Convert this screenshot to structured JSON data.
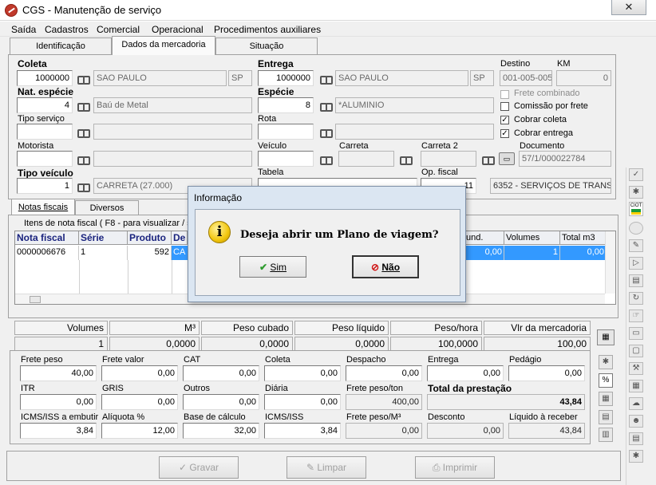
{
  "window": {
    "title": "CGS - Manutenção de serviço",
    "close": "✕"
  },
  "menu": [
    "Saída",
    "Cadastros",
    "Comercial",
    "Operacional",
    "Procedimentos auxiliares"
  ],
  "tabs": [
    "Identificação",
    "Dados da mercadoria",
    "Situação"
  ],
  "form": {
    "coleta": {
      "label": "Coleta",
      "code": "1000000",
      "city": "SAO PAULO",
      "uf": "SP"
    },
    "entrega": {
      "label": "Entrega",
      "code": "1000000",
      "city": "SAO PAULO",
      "uf": "SP"
    },
    "destino": {
      "label": "Destino",
      "value": "001-005-005"
    },
    "km": {
      "label": "KM",
      "value": "0"
    },
    "nat_especie": {
      "label": "Nat. espécie",
      "code": "4",
      "desc": "Baú de Metal"
    },
    "especie": {
      "label": "Espécie",
      "code": "8",
      "desc": "*ALUMINIO"
    },
    "frete_combinado": "Frete combinado",
    "comissao_frete": "Comissão por frete",
    "cobrar_coleta": "Cobrar coleta",
    "cobrar_entrega": "Cobrar entrega",
    "check_mark": "✓",
    "tipo_servico": {
      "label": "Tipo serviço",
      "code": "",
      "desc": ""
    },
    "rota": {
      "label": "Rota",
      "code": "",
      "desc": ""
    },
    "motorista": {
      "label": "Motorista",
      "value": ""
    },
    "veiculo": {
      "label": "Veículo",
      "value": ""
    },
    "carreta": {
      "label": "Carreta",
      "value": ""
    },
    "carreta2": {
      "label": "Carreta 2",
      "value": ""
    },
    "documento": {
      "label": "Documento",
      "value": "57/1/000022784"
    },
    "tipo_veiculo": {
      "label": "Tipo veículo",
      "code": "1",
      "desc": "CARRETA (27.000)"
    },
    "tabela": {
      "label": "Tabela"
    },
    "op_fiscal": {
      "label": "Op. fiscal",
      "code": "11",
      "desc": "6352 - SERVIÇOS DE TRANSPOI"
    }
  },
  "lower_tabs": [
    "Notas fiscais",
    "Diversos"
  ],
  "items_caption": "Itens de nota fiscal ( F8 - para visualizar / s",
  "grid": {
    "headers": [
      "Nota fiscal",
      "Série",
      "Produto",
      "De",
      "und.",
      "Volumes",
      "Total m3"
    ],
    "row": [
      "0000006676",
      "1",
      "592",
      "CA",
      "0,00",
      "1",
      "0,00"
    ]
  },
  "summary": {
    "headers": [
      "Volumes",
      "M³",
      "Peso cubado",
      "Peso líquido",
      "Peso/hora",
      "Vlr da mercadoria"
    ],
    "values": [
      "1",
      "0,0000",
      "0,0000",
      "0,0000",
      "100,0000",
      "100,00"
    ]
  },
  "financial": {
    "frete_peso": {
      "label": "Frete peso",
      "value": "40,00"
    },
    "frete_valor": {
      "label": "Frete valor",
      "value": "0,00"
    },
    "cat": {
      "label": "CAT",
      "value": "0,00"
    },
    "coleta": {
      "label": "Coleta",
      "value": "0,00"
    },
    "despacho": {
      "label": "Despacho",
      "value": "0,00"
    },
    "entrega": {
      "label": "Entrega",
      "value": "0,00"
    },
    "pedagio": {
      "label": "Pedágio",
      "value": "0,00"
    },
    "itr": {
      "label": "ITR",
      "value": "0,00"
    },
    "gris": {
      "label": "GRIS",
      "value": "0,00"
    },
    "outros": {
      "label": "Outros",
      "value": "0,00"
    },
    "diaria": {
      "label": "Diária",
      "value": "0,00"
    },
    "frete_peso_ton": {
      "label": "Frete peso/ton",
      "value": "400,00"
    },
    "total_prestacao": {
      "label": "Total da prestação",
      "value": "43,84"
    },
    "icms_embutir": {
      "label": "ICMS/ISS a embutir",
      "value": "3,84"
    },
    "aliquota": {
      "label": "Alíquota %",
      "value": "12,00"
    },
    "base_calculo": {
      "label": "Base de cálculo",
      "value": "32,00"
    },
    "icms_iss": {
      "label": "ICMS/ISS",
      "value": "3,84"
    },
    "frete_peso_m3": {
      "label": "Frete peso/M³",
      "value": "0,00"
    },
    "desconto": {
      "label": "Desconto",
      "value": "0,00"
    },
    "liquido": {
      "label": "Líquido à receber",
      "value": "43,84"
    }
  },
  "buttons": {
    "gravar": "Gravar",
    "limpar": "Limpar",
    "imprimir": "Imprimir"
  },
  "side_ciot": "CIOT",
  "dialog": {
    "title": "Informação",
    "message": "Deseja abrir um Plano de viagem?",
    "yes": "Sim",
    "no": "Não",
    "icon_glyph": "i"
  }
}
